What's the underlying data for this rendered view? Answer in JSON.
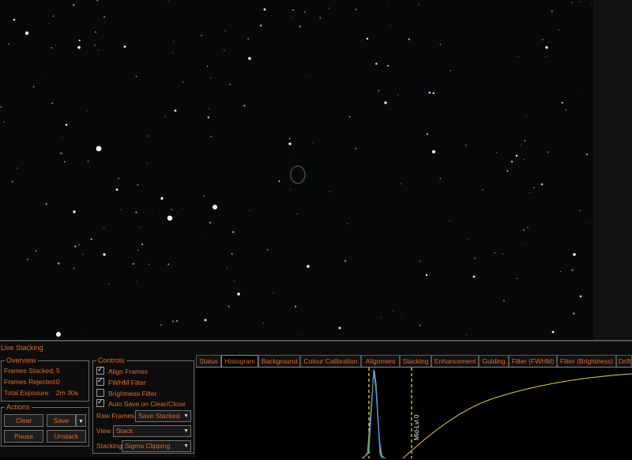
{
  "panel": {
    "title": "Live Stacking"
  },
  "overview": {
    "title": "Overview",
    "frames_stacked_label": "Frames Stacked:",
    "frames_stacked_value": "5",
    "frames_rejected_label": "Frames Rejected:",
    "frames_rejected_value": "0",
    "total_exposure_label": "Total Exposure:",
    "total_exposure_value": "2m 30s"
  },
  "actions": {
    "title": "Actions",
    "clear": "Clear",
    "save": "Save",
    "pause": "Pause",
    "unstack": "Unstack"
  },
  "controls": {
    "title": "Controls",
    "align_frames": {
      "label": "Align Frames",
      "checked": true
    },
    "fwhm_filter": {
      "label": "FWHM Filter",
      "checked": true
    },
    "brightness_filter": {
      "label": "Brightness Filter",
      "checked": false
    },
    "auto_save": {
      "label": "Auto Save on Clear/Close",
      "checked": true
    },
    "raw_frames_label": "Raw Frames",
    "raw_frames_value": "Save Stacked",
    "view_label": "View",
    "view_value": "Stack",
    "stacking_label": "Stacking",
    "stacking_value": "Sigma Clipping"
  },
  "tabs": [
    "Status",
    "Histogram",
    "Background",
    "Colour Calibration",
    "Alignment",
    "Stacking",
    "Enhancement",
    "Guiding",
    "Filter (FWHM)",
    "Filter (Brightness)",
    "Drift"
  ],
  "active_tab": "Histogram",
  "histogram": {
    "midpoint_label": "Mid-Lvl 0"
  },
  "colors": {
    "accent": "#e06a2a",
    "marker": "#f2e14a"
  }
}
